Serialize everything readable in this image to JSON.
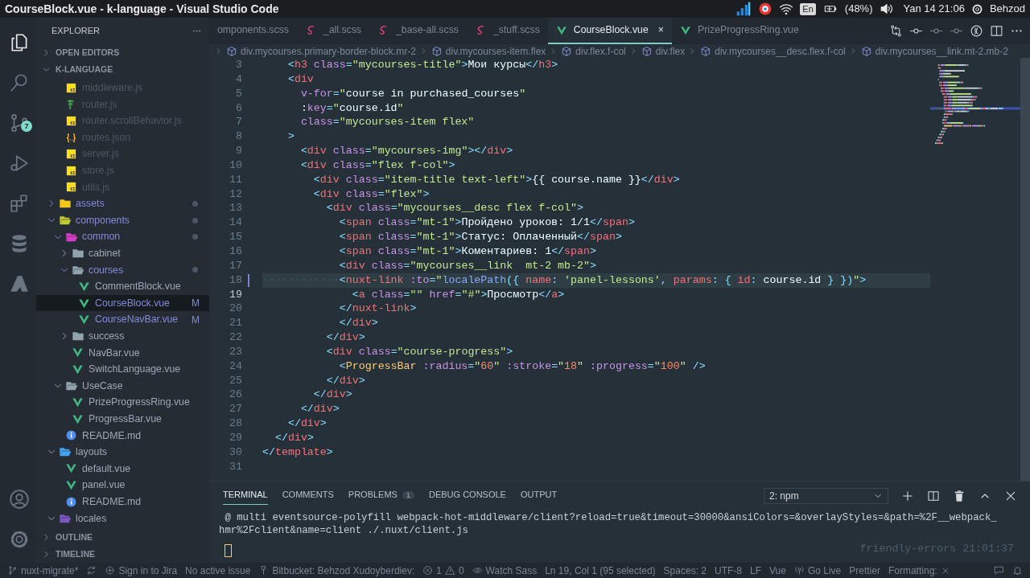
{
  "top_bar": {
    "title": "CourseBlock.vue - k-language - Visual Studio Code",
    "tray": [
      {
        "kind": "signal-app"
      },
      {
        "kind": "red-app"
      },
      {
        "kind": "wifi"
      },
      {
        "kind": "keyboard",
        "text": "En"
      },
      {
        "kind": "battery",
        "text": "(48%)"
      },
      {
        "kind": "volume"
      },
      {
        "kind": "clock",
        "text": "Yan 14 21:06"
      },
      {
        "kind": "user",
        "text": "Behzod"
      }
    ]
  },
  "activity_bar": {
    "items": [
      {
        "kind": "files",
        "selected": true
      },
      {
        "kind": "search",
        "selected": false
      },
      {
        "kind": "source-control",
        "selected": false,
        "badge": "7"
      },
      {
        "kind": "debug",
        "selected": false
      },
      {
        "kind": "extensions",
        "selected": false
      },
      {
        "kind": "database",
        "selected": false
      },
      {
        "kind": "azure",
        "selected": false
      }
    ],
    "bottom": [
      {
        "kind": "account"
      },
      {
        "kind": "settings"
      }
    ]
  },
  "sidebar": {
    "title": "EXPLORER",
    "more": "···",
    "sections": [
      {
        "label": "OPEN EDITORS",
        "expanded": false
      },
      {
        "label": "K-LANGUAGE",
        "expanded": true,
        "tree": [
          {
            "kind": "offscreen",
            "children": [
              {
                "label": "middleware.js",
                "kind": "js",
                "ignored": true,
                "changed": false,
                "selected": false
              },
              {
                "label": "router.js",
                "kind": "router",
                "ignored": true,
                "changed": false,
                "selected": false
              },
              {
                "label": "router.scrollBehavior.js",
                "kind": "js",
                "ignored": true,
                "changed": false,
                "selected": false
              },
              {
                "label": "routes.json",
                "kind": "json",
                "ignored": true,
                "changed": false,
                "selected": false
              },
              {
                "label": "server.js",
                "kind": "js",
                "ignored": true,
                "changed": false,
                "selected": false
              },
              {
                "label": "store.js",
                "kind": "js",
                "ignored": true,
                "changed": false,
                "selected": false
              },
              {
                "label": "utils.js",
                "kind": "js",
                "ignored": true,
                "changed": false,
                "selected": false
              }
            ]
          },
          {
            "label": "assets",
            "kind": "folder",
            "color": "#f5c518",
            "expanded": false,
            "ignored": false,
            "changed": true,
            "selected": false
          },
          {
            "label": "components",
            "kind": "folder",
            "color": "#c0ca33",
            "expanded": true,
            "ignored": false,
            "changed": true,
            "selected": false,
            "children": [
              {
                "label": "common",
                "kind": "folder",
                "color": "#d63dc8",
                "expanded": true,
                "ignored": false,
                "changed": true,
                "selected": false,
                "children": [
                  {
                    "label": "cabinet",
                    "kind": "folder",
                    "color": "#90a4ae",
                    "expanded": false,
                    "ignored": false,
                    "changed": false,
                    "selected": false
                  },
                  {
                    "label": "courses",
                    "kind": "folder",
                    "color": "#90a4ae",
                    "expanded": true,
                    "ignored": false,
                    "changed": true,
                    "selected": false,
                    "children": [
                      {
                        "label": "CommentBlock.vue",
                        "kind": "vue",
                        "ignored": false,
                        "changed": false,
                        "selected": false
                      },
                      {
                        "label": "CourseBlock.vue",
                        "kind": "vue",
                        "ignored": false,
                        "changed": true,
                        "selected": true,
                        "badge": "M"
                      },
                      {
                        "label": "CourseNavBar.vue",
                        "kind": "vue",
                        "ignored": false,
                        "changed": true,
                        "selected": false,
                        "badge": "M"
                      }
                    ]
                  },
                  {
                    "label": "success",
                    "kind": "folder",
                    "color": "#90a4ae",
                    "expanded": false,
                    "ignored": false,
                    "changed": false,
                    "selected": false
                  },
                  {
                    "label": "NavBar.vue",
                    "kind": "vue",
                    "ignored": false,
                    "changed": false,
                    "selected": false
                  },
                  {
                    "label": "SwitchLanguage.vue",
                    "kind": "vue",
                    "ignored": false,
                    "changed": false,
                    "selected": false
                  }
                ]
              },
              {
                "label": "UseCase",
                "kind": "folder",
                "color": "#90a4ae",
                "expanded": true,
                "ignored": false,
                "changed": false,
                "selected": false,
                "children": [
                  {
                    "label": "PrizeProgressRing.vue",
                    "kind": "vue",
                    "ignored": false,
                    "changed": false,
                    "selected": false
                  },
                  {
                    "label": "ProgressBar.vue",
                    "kind": "vue",
                    "ignored": false,
                    "changed": false,
                    "selected": false
                  }
                ]
              },
              {
                "label": "README.md",
                "kind": "info",
                "ignored": false,
                "changed": false,
                "selected": false
              }
            ]
          },
          {
            "label": "layouts",
            "kind": "folder",
            "color": "#42a5f5",
            "expanded": true,
            "ignored": false,
            "changed": false,
            "selected": false,
            "children": [
              {
                "label": "default.vue",
                "kind": "vue",
                "ignored": false,
                "changed": false,
                "selected": false
              },
              {
                "label": "panel.vue",
                "kind": "vue",
                "ignored": false,
                "changed": false,
                "selected": false
              },
              {
                "label": "README.md",
                "kind": "info",
                "ignored": false,
                "changed": false,
                "selected": false
              }
            ]
          },
          {
            "label": "locales",
            "kind": "folder",
            "color": "#7e57c2",
            "expanded": true,
            "ignored": false,
            "changed": false,
            "selected": false
          }
        ]
      },
      {
        "label": "OUTLINE",
        "expanded": false
      },
      {
        "label": "TIMELINE",
        "expanded": false
      }
    ]
  },
  "editor": {
    "tabs": [
      {
        "label": "omponents.scss",
        "kind": "plain",
        "selected": false
      },
      {
        "label": "_all.scss",
        "kind": "sass",
        "selected": false
      },
      {
        "label": "_base-all.scss",
        "kind": "sass",
        "selected": false
      },
      {
        "label": "_stuff.scss",
        "kind": "sass",
        "selected": false
      },
      {
        "label": "CourseBlock.vue",
        "kind": "vue",
        "selected": true,
        "close": "×"
      },
      {
        "label": "PrizeProgressRing.vue",
        "kind": "vue",
        "selected": false
      }
    ],
    "actions": [
      {
        "kind": "compare"
      },
      {
        "kind": "commit"
      },
      {
        "kind": "commit-dim"
      },
      {
        "kind": "commit-dim"
      },
      {
        "kind": "live-share"
      },
      {
        "kind": "split"
      },
      {
        "kind": "more"
      }
    ],
    "breadcrumbs": [
      "div.mycourses.primary-border-block.mr-2",
      "div.mycourses-item.flex",
      "div.flex.f-col",
      "div.flex",
      "div.mycourses__desc.flex.f-col",
      "div.mycourses__link.mt-2.mb-2"
    ],
    "lines": [
      {
        "number": "3",
        "selected": false,
        "current": false,
        "changed": false,
        "tokens": [
          {
            "kind": "punct",
            "text": "    <"
          },
          {
            "kind": "tag",
            "text": "h3"
          },
          {
            "kind": "attr",
            "text": " class"
          },
          {
            "kind": "punct",
            "text": "="
          },
          {
            "kind": "string",
            "text": "\"mycourses-title\""
          },
          {
            "kind": "punct",
            "text": ">"
          },
          {
            "kind": "text",
            "text": "Мои курсы"
          },
          {
            "kind": "punct",
            "text": "</"
          },
          {
            "kind": "tag",
            "text": "h3"
          },
          {
            "kind": "punct",
            "text": ">"
          }
        ]
      },
      {
        "number": "4",
        "selected": false,
        "current": false,
        "changed": false,
        "tokens": [
          {
            "kind": "punct",
            "text": "    <"
          },
          {
            "kind": "tag",
            "text": "div"
          }
        ]
      },
      {
        "number": "5",
        "selected": false,
        "current": false,
        "changed": false,
        "tokens": [
          {
            "kind": "attr",
            "text": "      v-for"
          },
          {
            "kind": "punct",
            "text": "="
          },
          {
            "kind": "string",
            "text": "\""
          },
          {
            "kind": "text",
            "text": "course in purchased_courses"
          },
          {
            "kind": "string",
            "text": "\""
          }
        ]
      },
      {
        "number": "6",
        "selected": false,
        "current": false,
        "changed": false,
        "tokens": [
          {
            "kind": "text",
            "text": "      :"
          },
          {
            "kind": "attr",
            "text": "key"
          },
          {
            "kind": "punct",
            "text": "="
          },
          {
            "kind": "string",
            "text": "\""
          },
          {
            "kind": "text",
            "text": "course.id"
          },
          {
            "kind": "string",
            "text": "\""
          }
        ]
      },
      {
        "number": "7",
        "selected": false,
        "current": false,
        "changed": false,
        "tokens": [
          {
            "kind": "attr",
            "text": "      class"
          },
          {
            "kind": "punct",
            "text": "="
          },
          {
            "kind": "string",
            "text": "\"mycourses-item flex\""
          }
        ]
      },
      {
        "number": "8",
        "selected": false,
        "current": false,
        "changed": false,
        "tokens": [
          {
            "kind": "punct",
            "text": "    >"
          }
        ]
      },
      {
        "number": "9",
        "selected": false,
        "current": false,
        "changed": false,
        "tokens": [
          {
            "kind": "punct",
            "text": "      <"
          },
          {
            "kind": "tag",
            "text": "div"
          },
          {
            "kind": "attr",
            "text": " class"
          },
          {
            "kind": "punct",
            "text": "="
          },
          {
            "kind": "string",
            "text": "\"mycourses-img\""
          },
          {
            "kind": "punct",
            "text": "></"
          },
          {
            "kind": "tag",
            "text": "div"
          },
          {
            "kind": "punct",
            "text": ">"
          }
        ]
      },
      {
        "number": "10",
        "selected": false,
        "current": false,
        "changed": false,
        "tokens": [
          {
            "kind": "punct",
            "text": "      <"
          },
          {
            "kind": "tag",
            "text": "div"
          },
          {
            "kind": "attr",
            "text": " class"
          },
          {
            "kind": "punct",
            "text": "="
          },
          {
            "kind": "string",
            "text": "\"flex f-col\""
          },
          {
            "kind": "punct",
            "text": ">"
          }
        ]
      },
      {
        "number": "11",
        "selected": false,
        "current": false,
        "changed": false,
        "tokens": [
          {
            "kind": "punct",
            "text": "        <"
          },
          {
            "kind": "tag",
            "text": "div"
          },
          {
            "kind": "attr",
            "text": " class"
          },
          {
            "kind": "punct",
            "text": "="
          },
          {
            "kind": "string",
            "text": "\"item-title text-left\""
          },
          {
            "kind": "punct",
            "text": ">"
          },
          {
            "kind": "text",
            "text": "{{ course.name }}"
          },
          {
            "kind": "punct",
            "text": "</"
          },
          {
            "kind": "tag",
            "text": "div"
          },
          {
            "kind": "punct",
            "text": ">"
          }
        ]
      },
      {
        "number": "12",
        "selected": false,
        "current": false,
        "changed": false,
        "tokens": [
          {
            "kind": "punct",
            "text": "        <"
          },
          {
            "kind": "tag",
            "text": "div"
          },
          {
            "kind": "attr",
            "text": " class"
          },
          {
            "kind": "punct",
            "text": "="
          },
          {
            "kind": "string",
            "text": "\"flex\""
          },
          {
            "kind": "punct",
            "text": ">"
          }
        ]
      },
      {
        "number": "13",
        "selected": false,
        "current": false,
        "changed": false,
        "tokens": [
          {
            "kind": "punct",
            "text": "          <"
          },
          {
            "kind": "tag",
            "text": "div"
          },
          {
            "kind": "attr",
            "text": " class"
          },
          {
            "kind": "punct",
            "text": "="
          },
          {
            "kind": "string",
            "text": "\"mycourses__desc flex f-col\""
          },
          {
            "kind": "punct",
            "text": ">"
          }
        ]
      },
      {
        "number": "14",
        "selected": false,
        "current": false,
        "changed": false,
        "tokens": [
          {
            "kind": "punct",
            "text": "            <"
          },
          {
            "kind": "tag",
            "text": "span"
          },
          {
            "kind": "attr",
            "text": " class"
          },
          {
            "kind": "punct",
            "text": "="
          },
          {
            "kind": "string",
            "text": "\"mt-1\""
          },
          {
            "kind": "punct",
            "text": ">"
          },
          {
            "kind": "text",
            "text": "Пройдено уроков: 1/1"
          },
          {
            "kind": "punct",
            "text": "</"
          },
          {
            "kind": "tag",
            "text": "span"
          },
          {
            "kind": "punct",
            "text": ">"
          }
        ]
      },
      {
        "number": "15",
        "selected": false,
        "current": false,
        "changed": false,
        "tokens": [
          {
            "kind": "punct",
            "text": "            <"
          },
          {
            "kind": "tag",
            "text": "span"
          },
          {
            "kind": "attr",
            "text": " class"
          },
          {
            "kind": "punct",
            "text": "="
          },
          {
            "kind": "string",
            "text": "\"mt-1\""
          },
          {
            "kind": "punct",
            "text": ">"
          },
          {
            "kind": "text",
            "text": "Статус: Оплаченный"
          },
          {
            "kind": "punct",
            "text": "</"
          },
          {
            "kind": "tag",
            "text": "span"
          },
          {
            "kind": "punct",
            "text": ">"
          }
        ]
      },
      {
        "number": "16",
        "selected": false,
        "current": false,
        "changed": false,
        "tokens": [
          {
            "kind": "punct",
            "text": "            <"
          },
          {
            "kind": "tag",
            "text": "span"
          },
          {
            "kind": "attr",
            "text": " class"
          },
          {
            "kind": "punct",
            "text": "="
          },
          {
            "kind": "string",
            "text": "\"mt-1\""
          },
          {
            "kind": "punct",
            "text": ">"
          },
          {
            "kind": "text",
            "text": "Коментариев: 1"
          },
          {
            "kind": "punct",
            "text": "</"
          },
          {
            "kind": "tag",
            "text": "span"
          },
          {
            "kind": "punct",
            "text": ">"
          }
        ]
      },
      {
        "number": "17",
        "selected": false,
        "current": false,
        "changed": false,
        "tokens": [
          {
            "kind": "punct",
            "text": "            <"
          },
          {
            "kind": "tag",
            "text": "div"
          },
          {
            "kind": "attr",
            "text": " class"
          },
          {
            "kind": "punct",
            "text": "="
          },
          {
            "kind": "string",
            "text": "\"mycourses__link  mt-2 mb-2\""
          },
          {
            "kind": "punct",
            "text": ">"
          }
        ]
      },
      {
        "number": "18",
        "selected": true,
        "current": false,
        "changed": true,
        "tokens": [
          {
            "kind": "whitespace",
            "text": "············"
          },
          {
            "kind": "punct",
            "text": "<"
          },
          {
            "kind": "tag",
            "text": "nuxt-link"
          },
          {
            "kind": "attr",
            "text": " :to"
          },
          {
            "kind": "punct",
            "text": "="
          },
          {
            "kind": "string",
            "text": "\""
          },
          {
            "kind": "function",
            "text": "localePath"
          },
          {
            "kind": "punct",
            "text": "({ "
          },
          {
            "kind": "tag",
            "text": "name"
          },
          {
            "kind": "punct",
            "text": ": "
          },
          {
            "kind": "string",
            "text": "'panel-lessons'"
          },
          {
            "kind": "punct",
            "text": ", "
          },
          {
            "kind": "tag",
            "text": "params"
          },
          {
            "kind": "punct",
            "text": ": { "
          },
          {
            "kind": "tag",
            "text": "id"
          },
          {
            "kind": "punct",
            "text": ": "
          },
          {
            "kind": "text",
            "text": "course.id"
          },
          {
            "kind": "punct",
            "text": " } })"
          },
          {
            "kind": "string",
            "text": "\""
          },
          {
            "kind": "punct",
            "text": ">"
          }
        ]
      },
      {
        "number": "19",
        "selected": false,
        "current": true,
        "changed": false,
        "tokens": [
          {
            "kind": "punct",
            "text": "              <"
          },
          {
            "kind": "tag",
            "text": "a"
          },
          {
            "kind": "attr",
            "text": " class"
          },
          {
            "kind": "punct",
            "text": "="
          },
          {
            "kind": "string",
            "text": "\"\""
          },
          {
            "kind": "attr",
            "text": " href"
          },
          {
            "kind": "punct",
            "text": "="
          },
          {
            "kind": "string",
            "text": "\"#\""
          },
          {
            "kind": "punct",
            "text": ">"
          },
          {
            "kind": "text",
            "text": "Просмотр"
          },
          {
            "kind": "punct",
            "text": "</"
          },
          {
            "kind": "tag",
            "text": "a"
          },
          {
            "kind": "punct",
            "text": ">"
          }
        ]
      },
      {
        "number": "20",
        "selected": false,
        "current": false,
        "changed": false,
        "tokens": [
          {
            "kind": "punct",
            "text": "            </"
          },
          {
            "kind": "tag",
            "text": "nuxt-link"
          },
          {
            "kind": "punct",
            "text": ">"
          }
        ]
      },
      {
        "number": "21",
        "selected": false,
        "current": false,
        "changed": false,
        "tokens": [
          {
            "kind": "punct",
            "text": "            </"
          },
          {
            "kind": "tag",
            "text": "div"
          },
          {
            "kind": "punct",
            "text": ">"
          }
        ]
      },
      {
        "number": "22",
        "selected": false,
        "current": false,
        "changed": false,
        "tokens": [
          {
            "kind": "punct",
            "text": "          </"
          },
          {
            "kind": "tag",
            "text": "div"
          },
          {
            "kind": "punct",
            "text": ">"
          }
        ]
      },
      {
        "number": "23",
        "selected": false,
        "current": false,
        "changed": false,
        "tokens": [
          {
            "kind": "punct",
            "text": "          <"
          },
          {
            "kind": "tag",
            "text": "div"
          },
          {
            "kind": "attr",
            "text": " class"
          },
          {
            "kind": "punct",
            "text": "="
          },
          {
            "kind": "string",
            "text": "\"course-progress\""
          },
          {
            "kind": "punct",
            "text": ">"
          }
        ]
      },
      {
        "number": "24",
        "selected": false,
        "current": false,
        "changed": false,
        "tokens": [
          {
            "kind": "punct",
            "text": "            <"
          },
          {
            "kind": "component",
            "text": "ProgressBar"
          },
          {
            "kind": "attr",
            "text": " :radius"
          },
          {
            "kind": "punct",
            "text": "="
          },
          {
            "kind": "string",
            "text": "\""
          },
          {
            "kind": "number",
            "text": "60"
          },
          {
            "kind": "string",
            "text": "\""
          },
          {
            "kind": "attr",
            "text": " :stroke"
          },
          {
            "kind": "punct",
            "text": "="
          },
          {
            "kind": "string",
            "text": "\""
          },
          {
            "kind": "number",
            "text": "18"
          },
          {
            "kind": "string",
            "text": "\""
          },
          {
            "kind": "attr",
            "text": " :progress"
          },
          {
            "kind": "punct",
            "text": "="
          },
          {
            "kind": "string",
            "text": "\""
          },
          {
            "kind": "number",
            "text": "100"
          },
          {
            "kind": "string",
            "text": "\""
          },
          {
            "kind": "punct",
            "text": " />"
          }
        ]
      },
      {
        "number": "25",
        "selected": false,
        "current": false,
        "changed": false,
        "tokens": [
          {
            "kind": "punct",
            "text": "          </"
          },
          {
            "kind": "tag",
            "text": "div"
          },
          {
            "kind": "punct",
            "text": ">"
          }
        ]
      },
      {
        "number": "26",
        "selected": false,
        "current": false,
        "changed": false,
        "tokens": [
          {
            "kind": "punct",
            "text": "        </"
          },
          {
            "kind": "tag",
            "text": "div"
          },
          {
            "kind": "punct",
            "text": ">"
          }
        ]
      },
      {
        "number": "27",
        "selected": false,
        "current": false,
        "changed": false,
        "tokens": [
          {
            "kind": "punct",
            "text": "      </"
          },
          {
            "kind": "tag",
            "text": "div"
          },
          {
            "kind": "punct",
            "text": ">"
          }
        ]
      },
      {
        "number": "28",
        "selected": false,
        "current": false,
        "changed": false,
        "tokens": [
          {
            "kind": "punct",
            "text": "    </"
          },
          {
            "kind": "tag",
            "text": "div"
          },
          {
            "kind": "punct",
            "text": ">"
          }
        ]
      },
      {
        "number": "29",
        "selected": false,
        "current": false,
        "changed": false,
        "tokens": [
          {
            "kind": "punct",
            "text": "  </"
          },
          {
            "kind": "tag",
            "text": "div"
          },
          {
            "kind": "punct",
            "text": ">"
          }
        ]
      },
      {
        "number": "30",
        "selected": false,
        "current": false,
        "changed": false,
        "tokens": [
          {
            "kind": "punct",
            "text": "</"
          },
          {
            "kind": "tag",
            "text": "template"
          },
          {
            "kind": "punct",
            "text": ">"
          }
        ]
      },
      {
        "number": "31",
        "selected": false,
        "current": false,
        "changed": false
      }
    ]
  },
  "panel": {
    "tabs": [
      {
        "label": "TERMINAL",
        "selected": true
      },
      {
        "label": "COMMENTS",
        "selected": false
      },
      {
        "label": "PROBLEMS",
        "selected": false,
        "badge": "1"
      },
      {
        "label": "DEBUG CONSOLE",
        "selected": false
      },
      {
        "label": "OUTPUT",
        "selected": false
      }
    ],
    "terminal_select": "2: npm",
    "actions": [
      {
        "kind": "plus"
      },
      {
        "kind": "split"
      },
      {
        "kind": "trash"
      },
      {
        "kind": "chevron-up"
      },
      {
        "kind": "close"
      }
    ],
    "terminal_lines": [
      " @ multi eventsource-polyfill webpack-hot-middleware/client?reload=true&timeout=30000&ansiColors=&overlayStyles=&path=%2F__webpack_",
      "hmr%2Fclient&name=client ./.nuxt/client.js"
    ],
    "terminal_status": "friendly-errors 21:01:37"
  },
  "status_bar": {
    "items": [
      {
        "kind": "branch",
        "text": "nuxt-migrate*"
      },
      {
        "kind": "sync"
      },
      {
        "kind": "jira",
        "text": "Sign in to Jira"
      },
      {
        "kind": "plain",
        "text": "No active issue"
      },
      {
        "kind": "bitbucket",
        "text": "Bitbucket: Behzod Xudoyberdiev:"
      },
      {
        "kind": "problems",
        "errors": "1",
        "warnings": "0"
      },
      {
        "kind": "eye",
        "text": "Watch Sass"
      },
      {
        "kind": "plain",
        "text": "Ln 19, Col 1 (95 selected)"
      },
      {
        "kind": "plain",
        "text": "Spaces: 2"
      },
      {
        "kind": "plain",
        "text": "UTF-8"
      },
      {
        "kind": "plain",
        "text": "LF"
      },
      {
        "kind": "plain",
        "text": "Vue"
      },
      {
        "kind": "live",
        "text": "Go Live"
      },
      {
        "kind": "plain",
        "text": "Prettier"
      },
      {
        "kind": "formatting",
        "text": "Formatting:"
      },
      {
        "kind": "feedback"
      },
      {
        "kind": "bell"
      }
    ]
  }
}
